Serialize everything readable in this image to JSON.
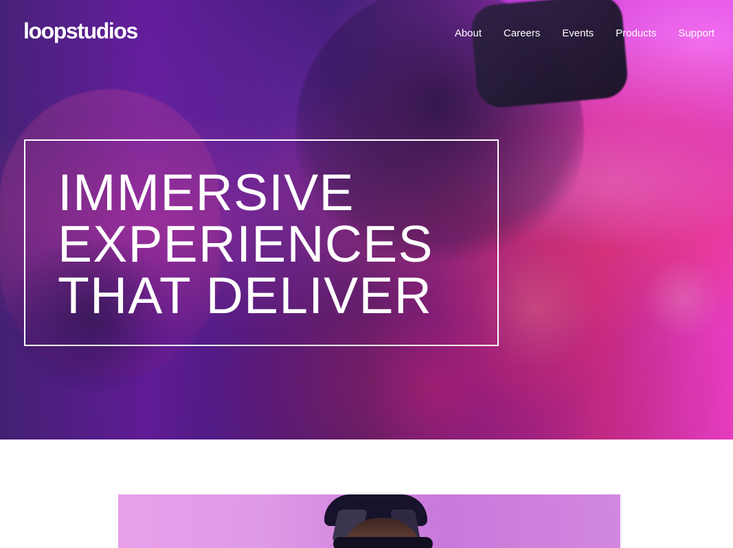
{
  "brand": {
    "logo_text": "loopstudios"
  },
  "nav": {
    "items": [
      {
        "label": "About"
      },
      {
        "label": "Careers"
      },
      {
        "label": "Events"
      },
      {
        "label": "Products"
      },
      {
        "label": "Support"
      }
    ]
  },
  "hero": {
    "headline_lines": [
      "IMMERSIVE",
      "EXPERIENCES",
      "THAT DELIVER"
    ]
  },
  "colors": {
    "text_on_hero": "#ffffff",
    "page_background": "#ffffff",
    "hero_magenta": "#ff42d5",
    "hero_purple": "#4a237f"
  }
}
